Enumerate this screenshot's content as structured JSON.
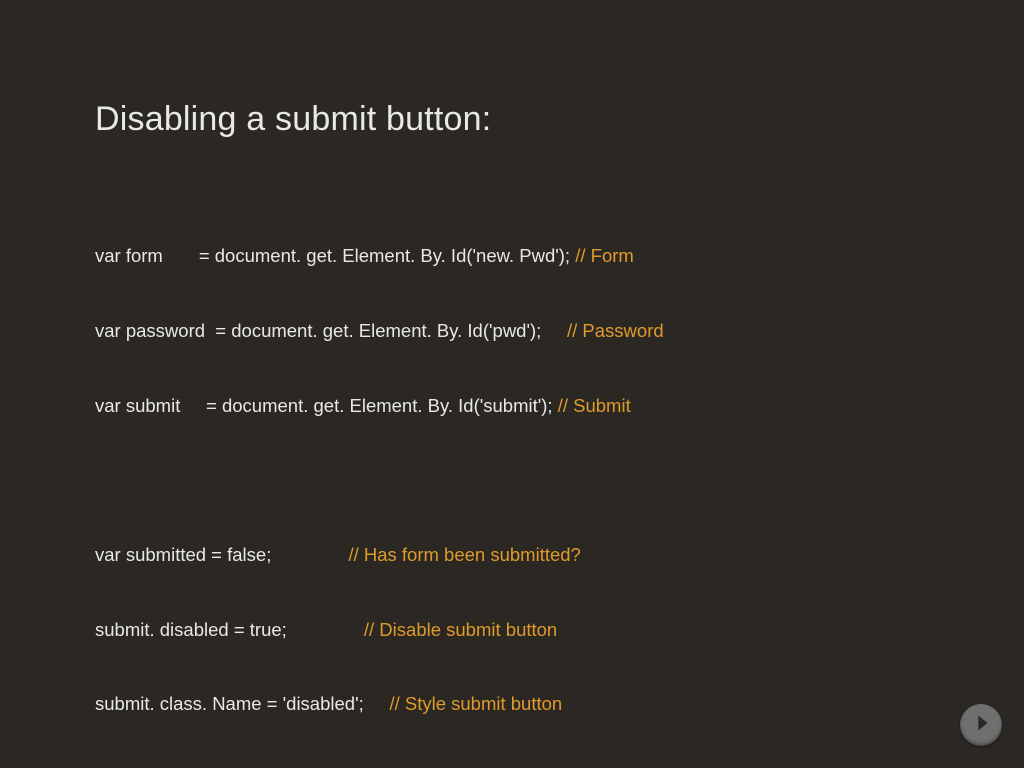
{
  "title": "Disabling a submit button:",
  "block1": {
    "l1": {
      "code": "var form       = document. get. Element. By. Id('new. Pwd'); ",
      "comment": "// Form"
    },
    "l2": {
      "code": "var password  = document. get. Element. By. Id('pwd');     ",
      "comment": "// Password"
    },
    "l3": {
      "code": "var submit     = document. get. Element. By. Id('submit'); ",
      "comment": "// Submit"
    }
  },
  "block2": {
    "l1": {
      "code": "var submitted = false;               ",
      "comment": "// Has form been submitted?"
    },
    "l2": {
      "code": "submit. disabled = true;               ",
      "comment": "// Disable submit button"
    },
    "l3": {
      "code": "submit. class. Name = 'disabled';     ",
      "comment": "// Style submit button"
    }
  },
  "colors": {
    "background": "#2b2824",
    "text": "#e8e8e8",
    "comment": "#e09a2b"
  }
}
